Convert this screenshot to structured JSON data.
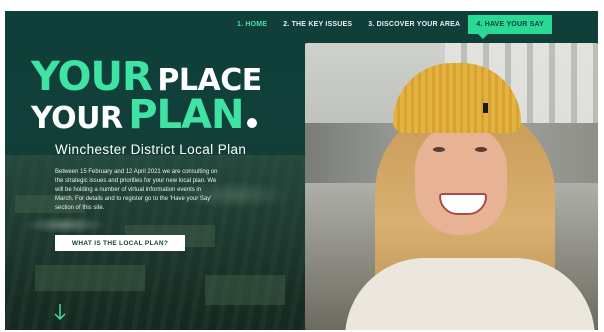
{
  "nav": {
    "items": [
      {
        "label": "1. HOME"
      },
      {
        "label": "2. THE KEY ISSUES"
      },
      {
        "label": "3. DISCOVER YOUR AREA"
      },
      {
        "label": "4. HAVE YOUR SAY"
      }
    ]
  },
  "hero": {
    "headline_line1_accent": "YOUR",
    "headline_line1_rest": "PLACE",
    "headline_line2_lead": "YOUR",
    "headline_line2_accent": "PLAN",
    "subtitle": "Winchester District Local Plan",
    "paragraph": "Between 15 February and 12 April 2021 we are consulting on the strategic issues and priorities for your new local plan. We will be holding a number of virtual information events in March. For details and to register go to the 'Have your Say' section of this site.",
    "cta_label": "WHAT IS THE LOCAL PLAN?"
  },
  "icons": {
    "scroll_down": "arrow-down-icon"
  },
  "colors": {
    "background": "#0f3f3b",
    "accent": "#3fe3a3",
    "active_tab": "#29d994"
  }
}
